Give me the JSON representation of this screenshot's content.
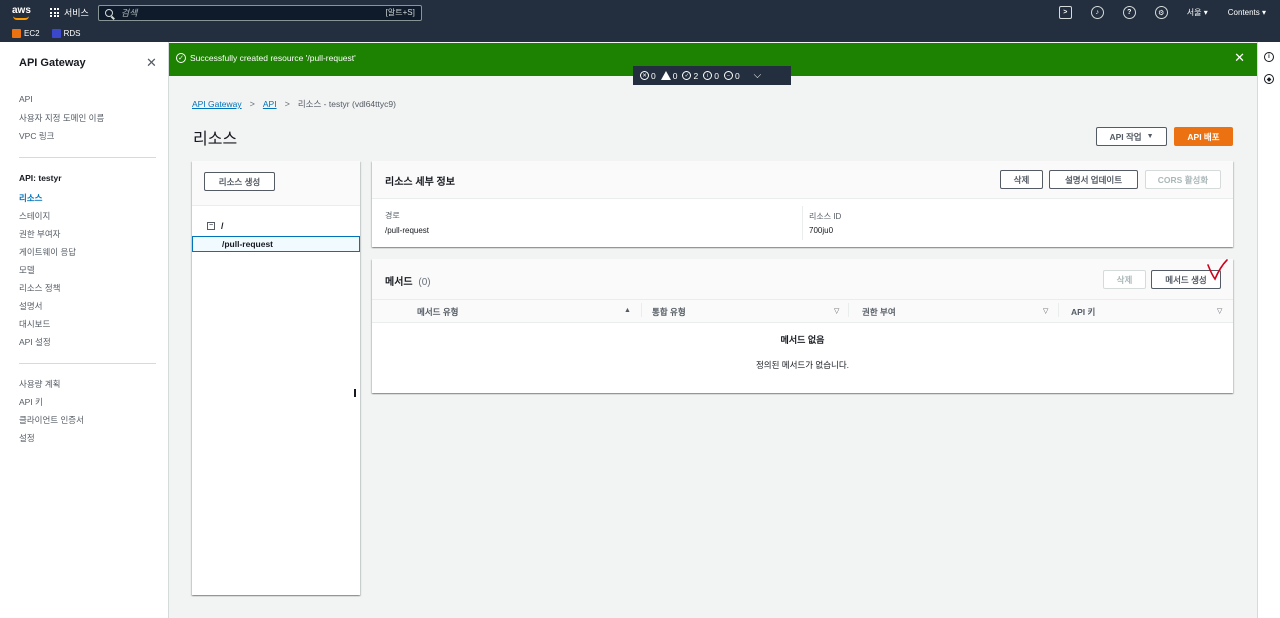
{
  "topbar": {
    "logo": "aws",
    "services_label": "서비스",
    "search_placeholder": "검색",
    "search_shortcut": "[알트+S]",
    "region": "서울 ▾",
    "contents": "Contents ▾"
  },
  "favorites": [
    {
      "label": "EC2",
      "color": "#ec7211"
    },
    {
      "label": "RDS",
      "color": "#3b48cc"
    }
  ],
  "sidenav": {
    "title": "API Gateway",
    "group1": [
      "API",
      "사용자 지정 도메인 이름",
      "VPC 링크"
    ],
    "api_section": "API: testyr",
    "group2": [
      "리소스",
      "스테이지",
      "권한 부여자",
      "게이트웨이 응답",
      "모델",
      "리소스 정책",
      "설명서",
      "대시보드",
      "API 설정"
    ],
    "active_item": "리소스",
    "group3": [
      "사용량 계획",
      "API 키",
      "클라이언트 인증서",
      "설정"
    ]
  },
  "flash": {
    "message": "Successfully created resource '/pull-request'",
    "color": "#1d8102"
  },
  "notifications": {
    "error": "0",
    "warning": "0",
    "success": "0",
    "success2": "2",
    "info": "0",
    "pending": "0"
  },
  "breadcrumb": {
    "items": [
      "API Gateway",
      "API"
    ],
    "current": "리소스 - testyr (vdl64ttyc9)"
  },
  "page": {
    "title": "리소스",
    "api_actions_label": "API 작업",
    "deploy_label": "API 배포"
  },
  "resources_panel": {
    "create_button": "리소스 생성",
    "root": "/",
    "child": "/pull-request"
  },
  "details_panel": {
    "title": "리소스 세부 정보",
    "delete_label": "삭제",
    "update_doc_label": "설명서 업데이트",
    "cors_label": "CORS 활성화",
    "path_label": "경로",
    "path_value": "/pull-request",
    "id_label": "리소스 ID",
    "id_value": "700ju0"
  },
  "methods_panel": {
    "title": "메서드",
    "count": "(0)",
    "delete_label": "삭제",
    "create_label": "메서드 생성",
    "columns": [
      "메서드 유형",
      "통합 유형",
      "권한 부여",
      "API 키"
    ],
    "empty_title": "메서드 없음",
    "empty_desc": "정의된 메서드가 없습니다."
  },
  "colors": {
    "accent": "#ec7211",
    "link": "#0073bb",
    "annotation": "#d0021b"
  }
}
